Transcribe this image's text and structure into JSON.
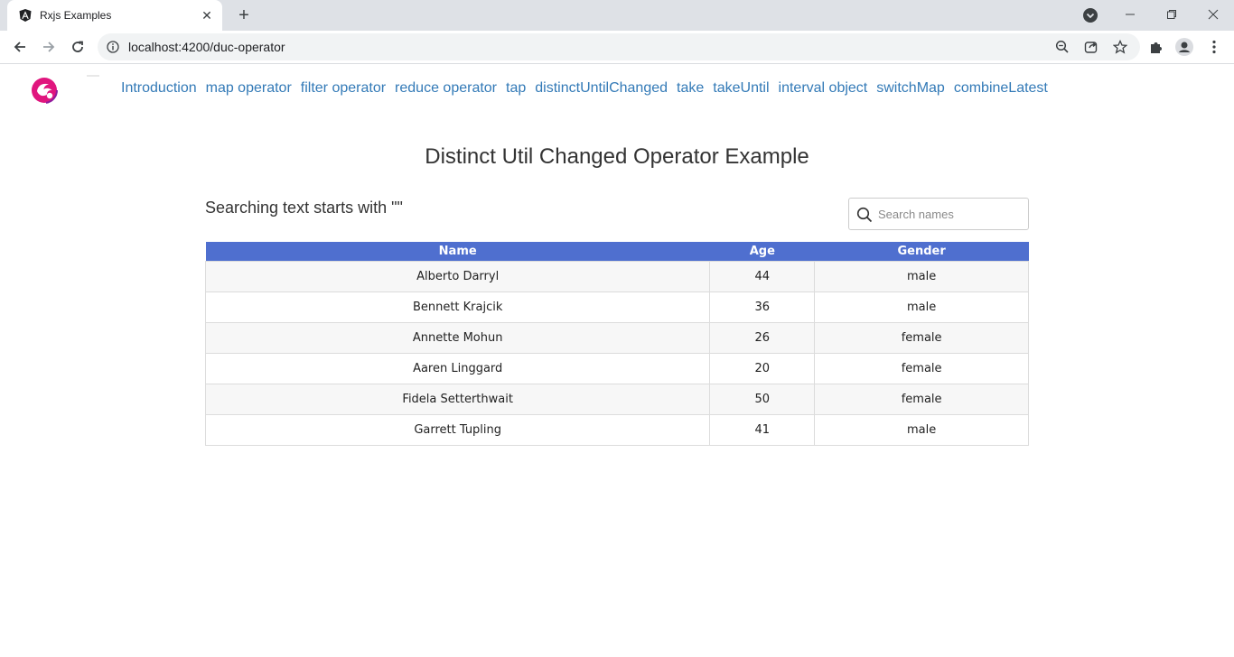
{
  "browser": {
    "tab_title": "Rxjs Examples",
    "url": "localhost:4200/duc-operator"
  },
  "nav": {
    "links": [
      "Introduction",
      "map operator",
      "filter operator",
      "reduce operator",
      "tap",
      "distinctUntilChanged",
      "take",
      "takeUntil",
      "interval object",
      "switchMap",
      "combineLatest"
    ]
  },
  "page": {
    "title": "Distinct Util Changed Operator Example",
    "search_caption": "Searching text starts with \"\"",
    "search_placeholder": "Search names",
    "search_value": ""
  },
  "table": {
    "headers": [
      "Name",
      "Age",
      "Gender"
    ],
    "rows": [
      [
        "Alberto Darryl",
        "44",
        "male"
      ],
      [
        "Bennett Krajcik",
        "36",
        "male"
      ],
      [
        "Annette Mohun",
        "26",
        "female"
      ],
      [
        "Aaren Linggard",
        "20",
        "female"
      ],
      [
        "Fidela Setterthwait",
        "50",
        "female"
      ],
      [
        "Garrett Tupling",
        "41",
        "male"
      ]
    ]
  },
  "colors": {
    "header_bg": "#4f6fcf",
    "link": "#337ab7",
    "logo": "#e0167e"
  }
}
